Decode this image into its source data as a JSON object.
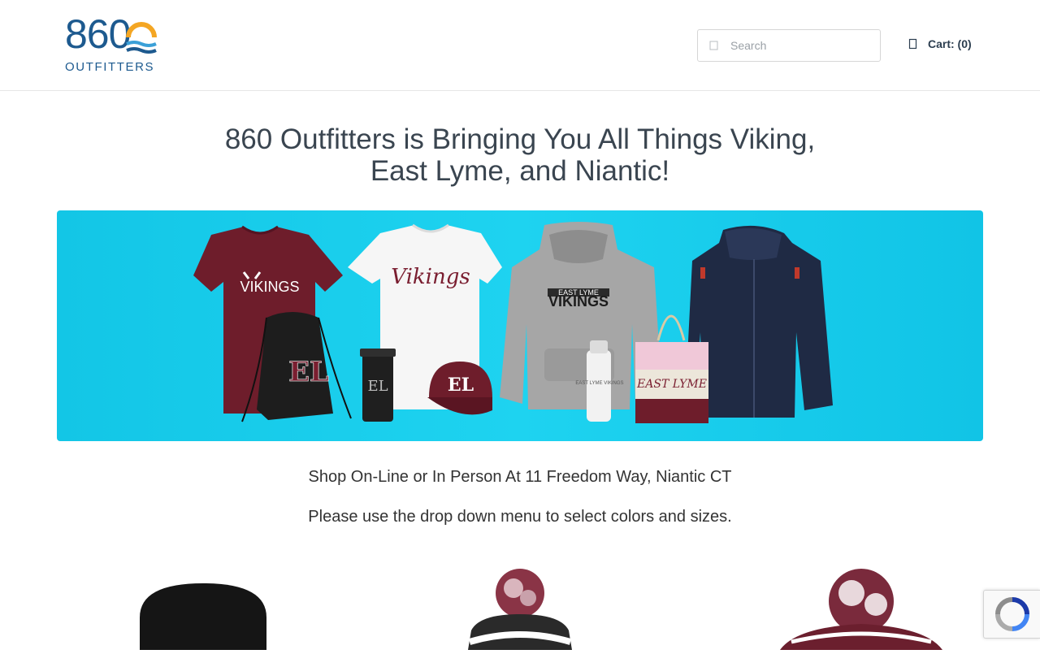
{
  "header": {
    "logo": {
      "number": "860",
      "word": "OUTFITTERS",
      "colors": {
        "blue": "#1d5a8f",
        "orange": "#f4a623",
        "wave": "#3aa0d8"
      }
    },
    "search": {
      "placeholder": "Search",
      "value": "",
      "icon": "search-icon"
    },
    "cart": {
      "label": "Cart: (0)",
      "icon": "cart-icon"
    }
  },
  "main": {
    "headline_line1": "860 Outfitters is Bringing You All Things Viking,",
    "headline_line2": "East Lyme, and Niantic!",
    "banner": {
      "background": "#13c6e6",
      "items": [
        {
          "name": "maroon-tshirt",
          "text": "VIKINGS"
        },
        {
          "name": "white-tshirt",
          "text": "Vikings"
        },
        {
          "name": "gray-hoodie",
          "text_top": "EAST LYME",
          "text_bottom": "VIKINGS"
        },
        {
          "name": "navy-jacket"
        },
        {
          "name": "drawstring-bag",
          "text": "EL"
        },
        {
          "name": "tumbler",
          "text": "EL"
        },
        {
          "name": "maroon-cap",
          "text": "EL"
        },
        {
          "name": "water-bottle",
          "text": "EAST LYME VIKINGS"
        },
        {
          "name": "tote-bag",
          "text": "EAST LYME"
        }
      ]
    },
    "info_line1": "Shop On-Line or In Person At 11 Freedom Way, Niantic CT",
    "info_line2": "Please use the drop down menu to select colors and sizes.",
    "products": [
      {
        "name": "black-beanie",
        "color": "#151515"
      },
      {
        "name": "pom-beanie-white-maroon",
        "color": "#6b1f2e"
      },
      {
        "name": "pom-beanie-maroon-stripe",
        "color": "#6b1f2e"
      }
    ]
  },
  "recaptcha": {
    "icon": "recaptcha-icon"
  }
}
